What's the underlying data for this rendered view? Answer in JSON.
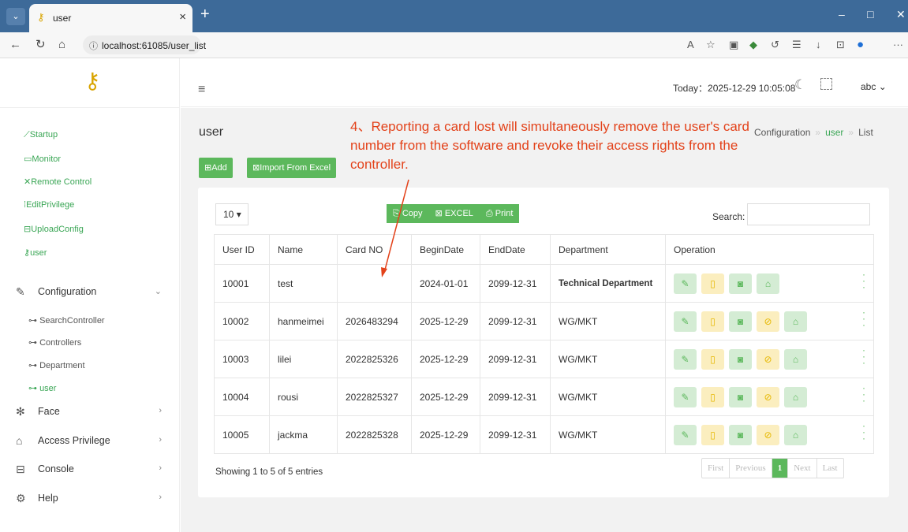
{
  "browser": {
    "tab_title": "user",
    "url": "localhost:61085/user_list",
    "new_tab_symbol": "+",
    "tab_close_symbol": "×"
  },
  "sidebar": {
    "links": [
      {
        "label": "Startup",
        "icon": "ruler-icon"
      },
      {
        "label": "Monitor",
        "icon": "monitor-icon"
      },
      {
        "label": "Remote Control",
        "icon": "remote-icon"
      },
      {
        "label": "EditPrivilege",
        "icon": "edit-icon"
      },
      {
        "label": "UploadConfig",
        "icon": "upload-icon"
      },
      {
        "label": "user",
        "icon": "user-icon"
      }
    ],
    "menus": {
      "configuration": "Configuration",
      "face": "Face",
      "access_privilege": "Access Privilege",
      "console": "Console",
      "help": "Help"
    },
    "submenu": [
      "SearchController",
      "Controllers",
      "Department",
      "user"
    ]
  },
  "header": {
    "today": "Today：2025-12-29 10:05:08",
    "user": "abc"
  },
  "page": {
    "title": "user",
    "breadcrumb": [
      "Configuration",
      "user",
      "List"
    ],
    "breadcrumb_sep": "»",
    "add_button": "Add",
    "import_button": "Import From Excel",
    "annotation": "4、Reporting a card lost will simultaneously remove the user's card number from the software and revoke their access rights from the controller."
  },
  "table": {
    "page_length": "10",
    "buttons": {
      "copy": "Copy",
      "excel": "EXCEL",
      "print": "Print"
    },
    "search_label": "Search:",
    "columns": [
      "User ID",
      "Name",
      "Card NO",
      "BeginDate",
      "EndDate",
      "Department",
      "Operation"
    ],
    "rows": [
      {
        "id": "10001",
        "name": "test",
        "card": "",
        "begin": "2024-01-01",
        "end": "2099-12-31",
        "dept": "Technical Department",
        "has_card": false
      },
      {
        "id": "10002",
        "name": "hanmeimei",
        "card": "2026483294",
        "begin": "2025-12-29",
        "end": "2099-12-31",
        "dept": "WG/MKT",
        "has_card": true
      },
      {
        "id": "10003",
        "name": "lilei",
        "card": "2022825326",
        "begin": "2025-12-29",
        "end": "2099-12-31",
        "dept": "WG/MKT",
        "has_card": true
      },
      {
        "id": "10004",
        "name": "rousi",
        "card": "2022825327",
        "begin": "2025-12-29",
        "end": "2099-12-31",
        "dept": "WG/MKT",
        "has_card": true
      },
      {
        "id": "10005",
        "name": "jackma",
        "card": "2022825328",
        "begin": "2025-12-29",
        "end": "2099-12-31",
        "dept": "WG/MKT",
        "has_card": true
      }
    ],
    "info": "Showing 1 to 5 of 5 entries",
    "pagination": {
      "first": "First",
      "previous": "Previous",
      "current": "1",
      "next": "Next",
      "last": "Last"
    }
  },
  "colors": {
    "accent": "#5cb85c",
    "warning": "#e6b800",
    "annotation": "#e3421a",
    "titlebar": "#3d6a99"
  }
}
